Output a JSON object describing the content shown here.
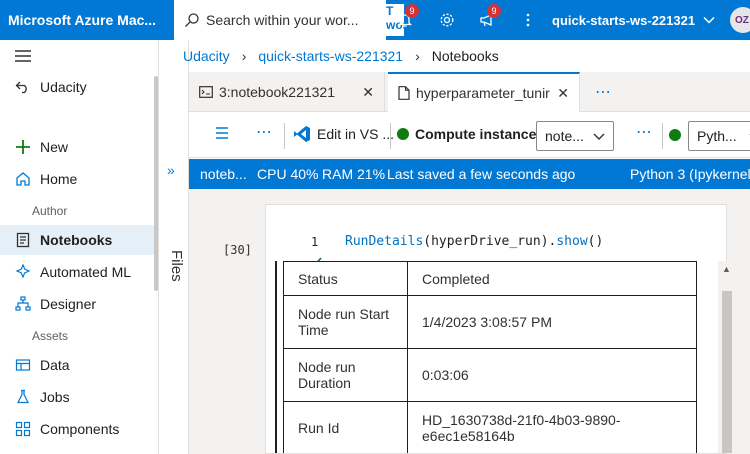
{
  "topbar": {
    "brand": "Microsoft Azure Mac...",
    "search_placeholder": "Search within your wor...",
    "ws_hint": "T work",
    "notifications_count": "9",
    "feedback_count": "9",
    "workspace": "quick-starts-ws-221321",
    "avatar_initials": "OZ"
  },
  "nav": {
    "back_label": "Udacity",
    "items": [
      {
        "label": "New",
        "icon": "plus-icon"
      },
      {
        "label": "Home",
        "icon": "home-icon"
      },
      {
        "label": "Notebooks",
        "icon": "notebook-icon"
      },
      {
        "label": "Automated ML",
        "icon": "automl-icon"
      },
      {
        "label": "Designer",
        "icon": "designer-icon"
      },
      {
        "label": "Data",
        "icon": "data-icon"
      },
      {
        "label": "Jobs",
        "icon": "jobs-icon"
      },
      {
        "label": "Components",
        "icon": "components-icon"
      }
    ],
    "section_author": "Author",
    "section_assets": "Assets"
  },
  "rail": {
    "label": "Files"
  },
  "breadcrumb": {
    "items": [
      "Udacity",
      "quick-starts-ws-221321",
      "Notebooks"
    ]
  },
  "tabs": [
    {
      "label": "3:notebook221321"
    },
    {
      "label": "hyperparameter_tunir"
    }
  ],
  "toolbar": {
    "edit_label": "Edit in VS ...",
    "compute_label": "Compute instance:",
    "compute_value": "note...",
    "kernel_value": "Pyth..."
  },
  "status": {
    "notebook": "noteb...",
    "cpu": "CPU 40%",
    "ram": "RAM 21%",
    "saved": "Last saved a few seconds ago",
    "kernel": "Python 3 (Ipykernel"
  },
  "cell": {
    "exec_count": "[30]",
    "line_number": "1",
    "code_fn": "RunDetails",
    "code_arg": "hyperDrive_run",
    "code_method": "show",
    "output": [
      {
        "key": "Status",
        "value": "Completed"
      },
      {
        "key": "Node run Start Time",
        "value": "1/4/2023 3:08:57 PM"
      },
      {
        "key": "Node run Duration",
        "value": "0:03:06"
      },
      {
        "key": "Run Id",
        "value": "HD_1630738d-21f0-4b03-9890-e6ec1e58164b"
      }
    ]
  },
  "colors": {
    "accent": "#0078d4",
    "running": "#107c10",
    "badge": "#d13438"
  }
}
